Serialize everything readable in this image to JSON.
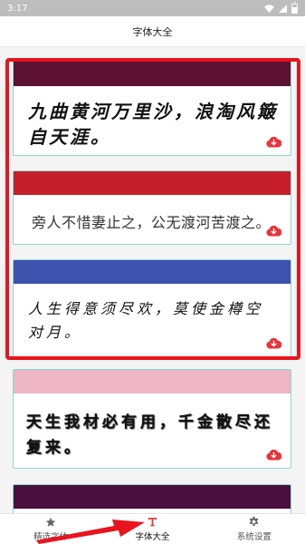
{
  "status_bar": {
    "time": "3:17"
  },
  "header": {
    "title": "字体大全"
  },
  "font_cards": [
    {
      "text": "九曲黄河万里沙，浪淘风簸自天涯。",
      "bar_color": "#5c1133"
    },
    {
      "text": "旁人不惜妻止之，公无渡河苦渡之。",
      "bar_color": "#c61f2c"
    },
    {
      "text": "人生得意须尽欢，莫使金樽空对月。",
      "bar_color": "#3e51ad"
    },
    {
      "text": "天生我材必有用，千金散尽还复来。",
      "bar_color": "#efb7c6"
    },
    {
      "text": "",
      "bar_color": "#4a0f3d"
    }
  ],
  "tabs": [
    {
      "label": "精选字体",
      "icon": "star-icon"
    },
    {
      "label": "字体大全",
      "icon": "font-t-icon",
      "active": true
    },
    {
      "label": "系统设置",
      "icon": "gear-icon"
    }
  ],
  "colors": {
    "accent": "#e8353b",
    "highlight": "#e8141e",
    "card_border": "#8ed4cf",
    "download": "#e8353b"
  }
}
